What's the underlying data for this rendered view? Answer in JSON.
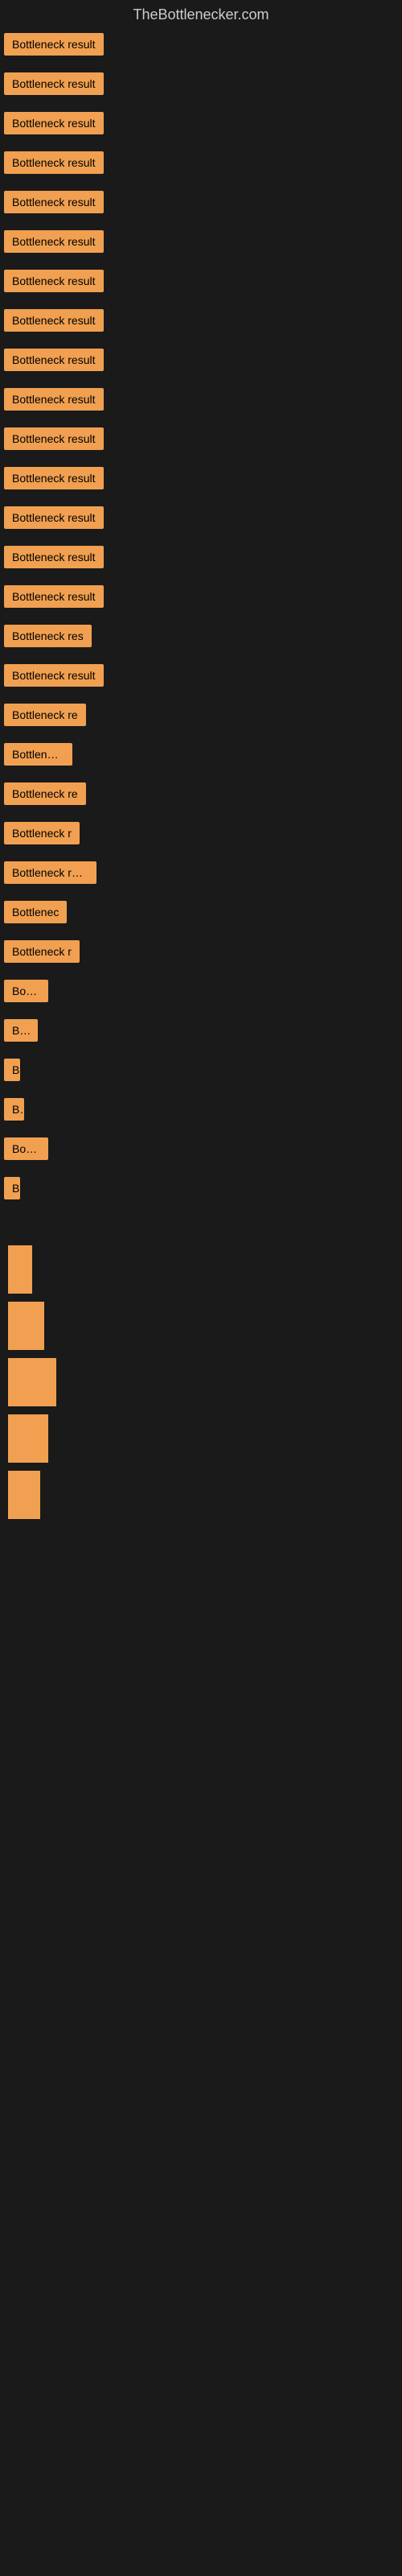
{
  "site": {
    "title": "TheBottlenecker.com"
  },
  "items": [
    {
      "label": "Bottleneck result",
      "width": 130,
      "visible": true
    },
    {
      "label": "Bottleneck result",
      "width": 130,
      "visible": true
    },
    {
      "label": "Bottleneck result",
      "width": 130,
      "visible": true
    },
    {
      "label": "Bottleneck result",
      "width": 130,
      "visible": true
    },
    {
      "label": "Bottleneck result",
      "width": 130,
      "visible": true
    },
    {
      "label": "Bottleneck result",
      "width": 130,
      "visible": true
    },
    {
      "label": "Bottleneck result",
      "width": 130,
      "visible": true
    },
    {
      "label": "Bottleneck result",
      "width": 130,
      "visible": true
    },
    {
      "label": "Bottleneck result",
      "width": 130,
      "visible": true
    },
    {
      "label": "Bottleneck result",
      "width": 130,
      "visible": true
    },
    {
      "label": "Bottleneck result",
      "width": 130,
      "visible": true
    },
    {
      "label": "Bottleneck result",
      "width": 130,
      "visible": true
    },
    {
      "label": "Bottleneck result",
      "width": 130,
      "visible": true
    },
    {
      "label": "Bottleneck result",
      "width": 130,
      "visible": true
    },
    {
      "label": "Bottleneck result",
      "width": 130,
      "visible": true
    },
    {
      "label": "Bottleneck res",
      "width": 110,
      "visible": true
    },
    {
      "label": "Bottleneck result",
      "width": 130,
      "visible": true
    },
    {
      "label": "Bottleneck re",
      "width": 105,
      "visible": true
    },
    {
      "label": "Bottleneck",
      "width": 85,
      "visible": true
    },
    {
      "label": "Bottleneck re",
      "width": 105,
      "visible": true
    },
    {
      "label": "Bottleneck r",
      "width": 95,
      "visible": true
    },
    {
      "label": "Bottleneck resu",
      "width": 115,
      "visible": true
    },
    {
      "label": "Bottlenec",
      "width": 80,
      "visible": true
    },
    {
      "label": "Bottleneck r",
      "width": 95,
      "visible": true
    },
    {
      "label": "Bottle",
      "width": 55,
      "visible": true
    },
    {
      "label": "Bott",
      "width": 42,
      "visible": true
    },
    {
      "label": "B",
      "width": 18,
      "visible": true
    },
    {
      "label": "Bo",
      "width": 25,
      "visible": true
    },
    {
      "label": "Bottle",
      "width": 55,
      "visible": true
    },
    {
      "label": "B",
      "width": 15,
      "visible": true
    }
  ]
}
